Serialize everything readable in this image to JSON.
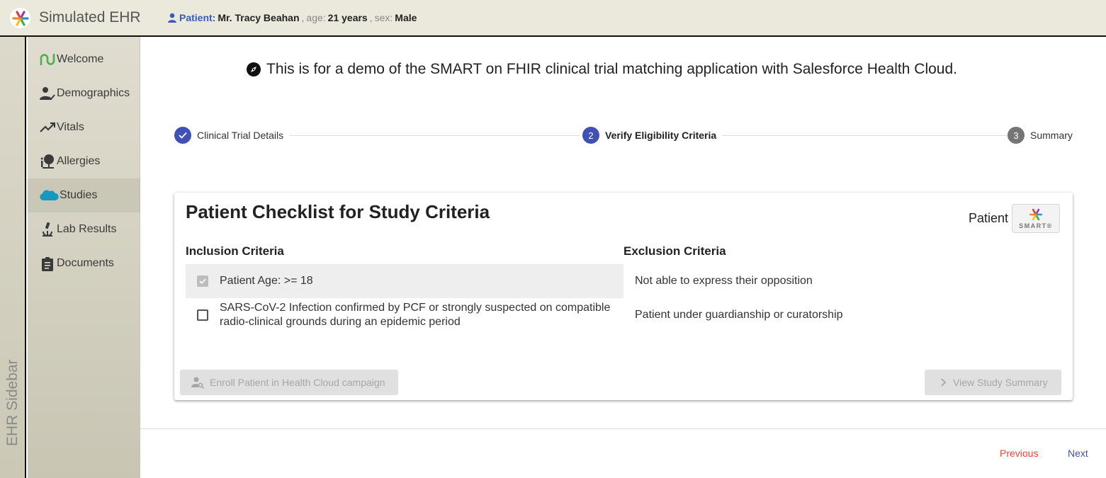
{
  "app": {
    "title": "Simulated EHR",
    "sidebar_label": "EHR Sidebar"
  },
  "patient": {
    "label": "Patient:",
    "name": "Mr. Tracy Beahan",
    "age_label": "age:",
    "age": "21 years",
    "sex_label": "sex:",
    "sex": "Male"
  },
  "sidebar": {
    "items": [
      {
        "label": "Welcome",
        "icon": "welcome-wave-icon",
        "active": false
      },
      {
        "label": "Demographics",
        "icon": "person-check-icon",
        "active": false
      },
      {
        "label": "Vitals",
        "icon": "trending-up-icon",
        "active": false
      },
      {
        "label": "Allergies",
        "icon": "allergy-tree-icon",
        "active": false
      },
      {
        "label": "Studies",
        "icon": "salesforce-cloud-icon",
        "active": true
      },
      {
        "label": "Lab Results",
        "icon": "microscope-icon",
        "active": false
      },
      {
        "label": "Documents",
        "icon": "clipboard-icon",
        "active": false
      }
    ]
  },
  "banner": {
    "icon": "compass-icon",
    "text": "This is for a demo of the SMART on FHIR clinical trial matching application with Salesforce Health Cloud."
  },
  "stepper": {
    "steps": [
      {
        "number": "1",
        "label": "Clinical Trial Details",
        "state": "completed"
      },
      {
        "number": "2",
        "label": "Verify Eligibility Criteria",
        "state": "active"
      },
      {
        "number": "3",
        "label": "Summary",
        "state": "pending"
      }
    ]
  },
  "checklist": {
    "title": "Patient Checklist for Study Criteria",
    "badge_label": "Patient",
    "smart_logo_text": "SMART®",
    "inclusion_header": "Inclusion Criteria",
    "exclusion_header": "Exclusion Criteria",
    "inclusion": [
      {
        "text": "Patient Age: >= 18",
        "checked": true
      },
      {
        "text": "SARS-CoV-2 Infection confirmed by PCF or strongly suspected on compatible radio-clinical grounds during an epidemic period",
        "checked": false
      }
    ],
    "exclusion": [
      {
        "text": "Not able to express their opposition"
      },
      {
        "text": "Patient under guardianship or curatorship"
      }
    ],
    "enroll_button": "Enroll Patient in Health Cloud campaign",
    "summary_button": "View Study Summary"
  },
  "footer": {
    "previous": "Previous",
    "next": "Next"
  },
  "colors": {
    "accent": "#3f51b5",
    "pending_step": "#757575",
    "previous": "#f44336",
    "next": "#3f51b5",
    "patient_label": "#3c5bb5"
  }
}
